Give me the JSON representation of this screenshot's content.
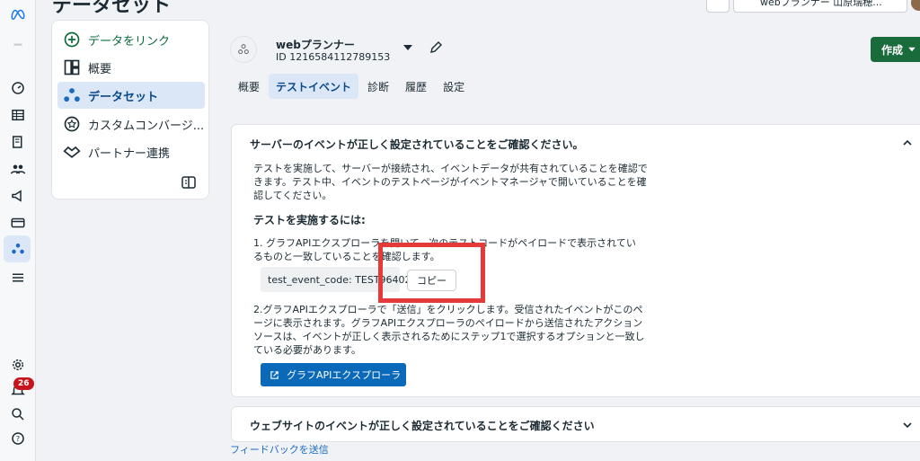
{
  "header": {
    "page_title": "データセット",
    "account_label": "webプランナー 山原瑞穂..."
  },
  "sidebar": {
    "items": [
      {
        "label": "データをリンク",
        "icon": "plus-circle-icon"
      },
      {
        "label": "概要",
        "icon": "layout-icon"
      },
      {
        "label": "データセット",
        "icon": "dataset-icon",
        "active": true
      },
      {
        "label": "カスタムコンバージ...",
        "icon": "star-badge-icon"
      },
      {
        "label": "パートナー連携",
        "icon": "handshake-icon"
      }
    ]
  },
  "dataset": {
    "name": "webプランナー",
    "id": "ID 1216584112789153"
  },
  "create_button": "作成",
  "tabs": [
    "概要",
    "テストイベント",
    "診断",
    "履歴",
    "設定"
  ],
  "active_tab": "テストイベント",
  "server_section": {
    "title": "サーバーのイベントが正しく設定されていることをご確認ください。",
    "description": "テストを実施して、サーバーが接続され、イベントデータが共有されていることを確認できます。テスト中、イベントのテストページがイベントマネージャで開いていることを確認してください。",
    "how_to_title": "テストを実施するには:",
    "step1": "1. グラフAPIエクスプローラを開いて、次のテストコードがペイロードで表示されているものと一致していることを確認します。",
    "test_code": "test_event_code: TEST96402",
    "copy_label": "コピー",
    "step2": "2.グラフAPIエクスプローラで「送信」をクリックします。受信されたイベントがこのページに表示されます。グラフAPIエクスプローラのペイロードから送信されたアクションソースは、イベントが正しく表示されるためにステップ1で選択するオプションと一致している必要があります。",
    "explorer_button": "グラフAPIエクスプローラ"
  },
  "website_section": {
    "title": "ウェブサイトのイベントが正しく設定されていることをご確認ください"
  },
  "feedback_link": "フィードバックを送信",
  "notifications_count": "26",
  "colors": {
    "accent_blue": "#0a69b8",
    "create_green": "#1a6b3c",
    "highlight_red": "#e53a3a",
    "badge_red": "#c4161c"
  }
}
